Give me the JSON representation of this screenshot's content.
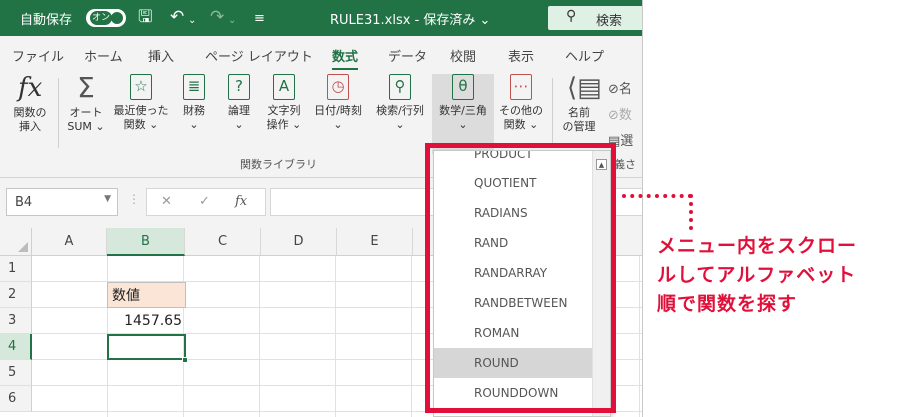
{
  "titlebar": {
    "autosave_label": "自動保存",
    "autosave_state": "オン",
    "filename": "RULE31.xlsx - 保存済み ⌄",
    "search_label": "検索",
    "bg_color": "#217346"
  },
  "tabs": [
    {
      "label": "ファイル"
    },
    {
      "label": "ホーム"
    },
    {
      "label": "挿入"
    },
    {
      "label": "ページ レイアウト"
    },
    {
      "label": "数式",
      "active": true
    },
    {
      "label": "データ"
    },
    {
      "label": "校閲"
    },
    {
      "label": "表示"
    },
    {
      "label": "ヘルプ"
    }
  ],
  "ribbon": {
    "buttons": [
      {
        "line1": "関数の",
        "line2": "挿入",
        "icon": "fx-icon"
      },
      {
        "line1": "オート",
        "line2": "SUM ⌄",
        "icon": "sigma-icon"
      },
      {
        "line1": "最近使った",
        "line2": "関数 ⌄",
        "icon": "star-book-icon"
      },
      {
        "line1": "財務",
        "line2": "⌄",
        "icon": "coins-book-icon"
      },
      {
        "line1": "論理",
        "line2": "⌄",
        "icon": "question-book-icon"
      },
      {
        "line1": "文字列",
        "line2": "操作 ⌄",
        "icon": "text-book-icon"
      },
      {
        "line1": "日付/時刻",
        "line2": "⌄",
        "icon": "clock-book-icon"
      },
      {
        "line1": "検索/行列",
        "line2": "⌄",
        "icon": "search-book-icon"
      },
      {
        "line1": "数学/三角",
        "line2": "⌄",
        "icon": "theta-book-icon"
      },
      {
        "line1": "その他の",
        "line2": "関数 ⌄",
        "icon": "more-book-icon"
      },
      {
        "line1": "名前",
        "line2": "の管理",
        "icon": "name-manager-icon"
      }
    ],
    "group_label": "関数ライブラリ",
    "right_glyphs": [
      "名",
      "数",
      "選",
      "義さ"
    ]
  },
  "formula_bar": {
    "name_box": "B4",
    "cancel": "✕",
    "enter": "✓",
    "fx": "fx",
    "content": ""
  },
  "grid": {
    "columns": [
      "A",
      "B",
      "C",
      "D",
      "E"
    ],
    "rows": [
      "1",
      "2",
      "3",
      "4",
      "5",
      "6"
    ],
    "cells": {
      "B2": "数値",
      "B3": "1457.65"
    },
    "active_cell": "B4"
  },
  "menu": {
    "partial_top": "PRODUCT",
    "items": [
      "QUOTIENT",
      "RADIANS",
      "RAND",
      "RANDARRAY",
      "RANDBETWEEN",
      "ROMAN",
      "ROUND",
      "ROUNDDOWN"
    ],
    "highlighted": "ROUND"
  },
  "annotation": {
    "lines": [
      "メニュー内をスクロー",
      "ルしてアルファベット",
      "順で関数を探す"
    ],
    "color": "#e0103a"
  }
}
